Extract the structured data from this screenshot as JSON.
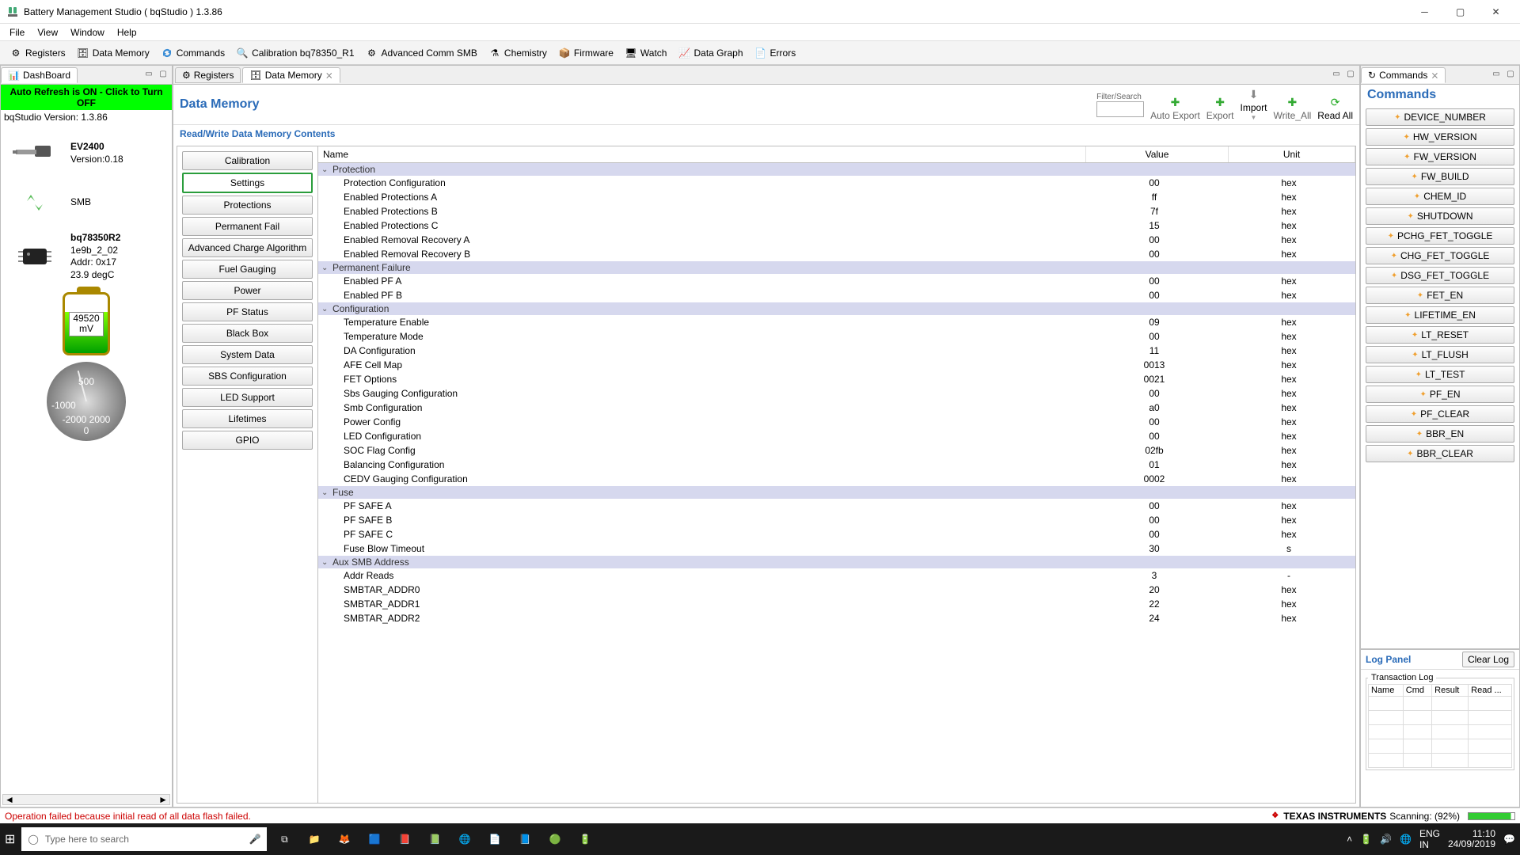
{
  "window": {
    "title": "Battery Management Studio ( bqStudio ) 1.3.86"
  },
  "menu": [
    "File",
    "View",
    "Window",
    "Help"
  ],
  "toolbar": [
    {
      "label": "Registers"
    },
    {
      "label": "Data Memory"
    },
    {
      "label": "Commands"
    },
    {
      "label": "Calibration bq78350_R1"
    },
    {
      "label": "Advanced Comm SMB"
    },
    {
      "label": "Chemistry"
    },
    {
      "label": "Firmware"
    },
    {
      "label": "Watch"
    },
    {
      "label": "Data Graph"
    },
    {
      "label": "Errors"
    }
  ],
  "dashboard": {
    "tab": "DashBoard",
    "auto_refresh": "Auto Refresh is ON - Click to Turn OFF",
    "version_line": "bqStudio Version: 1.3.86",
    "adapter": {
      "name": "EV2400",
      "ver": "Version:0.18"
    },
    "bus": "SMB",
    "chip": {
      "name": "bq78350R2",
      "fw": "1e9b_2_02",
      "addr": "Addr: 0x17",
      "temp": "23.9 degC"
    },
    "battery_mv": "49520",
    "battery_unit": "mV",
    "dial_labels": {
      "t500": "500",
      "tn1000": "-1000",
      "tn2000": "-2000 2000",
      "t0": "0"
    }
  },
  "center_tabs": {
    "registers": "Registers",
    "data_memory": "Data Memory"
  },
  "data_memory": {
    "title": "Data Memory",
    "search_label": "Filter/Search",
    "actions": {
      "auto_export": "Auto Export",
      "export": "Export",
      "import": "Import",
      "write_all": "Write_All",
      "read_all": "Read All"
    },
    "section_title": "Read/Write Data Memory Contents",
    "categories": [
      "Calibration",
      "Settings",
      "Protections",
      "Permanent Fail",
      "Advanced Charge Algorithm",
      "Fuel Gauging",
      "Power",
      "PF Status",
      "Black Box",
      "System Data",
      "SBS Configuration",
      "LED Support",
      "Lifetimes",
      "GPIO"
    ],
    "selected_category": "Settings",
    "columns": {
      "name": "Name",
      "value": "Value",
      "unit": "Unit"
    },
    "groups": [
      {
        "name": "Protection",
        "rows": [
          {
            "n": "Protection Configuration",
            "v": "00",
            "u": "hex"
          },
          {
            "n": "Enabled Protections A",
            "v": "ff",
            "u": "hex"
          },
          {
            "n": "Enabled Protections B",
            "v": "7f",
            "u": "hex"
          },
          {
            "n": "Enabled Protections C",
            "v": "15",
            "u": "hex"
          },
          {
            "n": "Enabled Removal Recovery A",
            "v": "00",
            "u": "hex"
          },
          {
            "n": "Enabled Removal Recovery B",
            "v": "00",
            "u": "hex"
          }
        ]
      },
      {
        "name": "Permanent Failure",
        "rows": [
          {
            "n": "Enabled PF A",
            "v": "00",
            "u": "hex"
          },
          {
            "n": "Enabled PF B",
            "v": "00",
            "u": "hex"
          }
        ]
      },
      {
        "name": "Configuration",
        "rows": [
          {
            "n": "Temperature Enable",
            "v": "09",
            "u": "hex"
          },
          {
            "n": "Temperature Mode",
            "v": "00",
            "u": "hex"
          },
          {
            "n": "DA Configuration",
            "v": "11",
            "u": "hex"
          },
          {
            "n": "AFE Cell Map",
            "v": "0013",
            "u": "hex"
          },
          {
            "n": "FET Options",
            "v": "0021",
            "u": "hex"
          },
          {
            "n": "Sbs Gauging Configuration",
            "v": "00",
            "u": "hex"
          },
          {
            "n": "Smb Configuration",
            "v": "a0",
            "u": "hex"
          },
          {
            "n": "Power Config",
            "v": "00",
            "u": "hex"
          },
          {
            "n": "LED Configuration",
            "v": "00",
            "u": "hex"
          },
          {
            "n": "SOC Flag Config",
            "v": "02fb",
            "u": "hex"
          },
          {
            "n": "Balancing Configuration",
            "v": "01",
            "u": "hex"
          },
          {
            "n": "CEDV Gauging Configuration",
            "v": "0002",
            "u": "hex"
          }
        ]
      },
      {
        "name": "Fuse",
        "rows": [
          {
            "n": "PF SAFE A",
            "v": "00",
            "u": "hex"
          },
          {
            "n": "PF SAFE B",
            "v": "00",
            "u": "hex"
          },
          {
            "n": "PF SAFE C",
            "v": "00",
            "u": "hex"
          },
          {
            "n": "Fuse Blow Timeout",
            "v": "30",
            "u": "s"
          }
        ]
      },
      {
        "name": "Aux SMB Address",
        "rows": [
          {
            "n": "Addr Reads",
            "v": "3",
            "u": "-"
          },
          {
            "n": "SMBTAR_ADDR0",
            "v": "20",
            "u": "hex"
          },
          {
            "n": "SMBTAR_ADDR1",
            "v": "22",
            "u": "hex"
          },
          {
            "n": "SMBTAR_ADDR2",
            "v": "24",
            "u": "hex"
          }
        ]
      }
    ]
  },
  "commands": {
    "tab": "Commands",
    "title": "Commands",
    "items": [
      "DEVICE_NUMBER",
      "HW_VERSION",
      "FW_VERSION",
      "FW_BUILD",
      "CHEM_ID",
      "SHUTDOWN",
      "PCHG_FET_TOGGLE",
      "CHG_FET_TOGGLE",
      "DSG_FET_TOGGLE",
      "FET_EN",
      "LIFETIME_EN",
      "LT_RESET",
      "LT_FLUSH",
      "LT_TEST",
      "PF_EN",
      "PF_CLEAR",
      "BBR_EN",
      "BBR_CLEAR"
    ]
  },
  "log": {
    "title": "Log Panel",
    "clear": "Clear Log",
    "fieldset": "Transaction Log",
    "cols": [
      "Name",
      "Cmd",
      "Result",
      "Read ..."
    ]
  },
  "status": {
    "error": "Operation failed because initial read of all data flash failed.",
    "brand": "TEXAS INSTRUMENTS",
    "scan": "Scanning: (92%)"
  },
  "taskbar": {
    "search_placeholder": "Type here to search",
    "lang1": "ENG",
    "lang2": "IN",
    "time": "11:10",
    "date": "24/09/2019"
  }
}
